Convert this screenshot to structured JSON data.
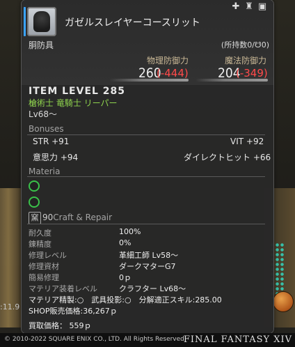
{
  "item": {
    "name": "ガゼルスレイヤーコースリット",
    "slot": "胴防具",
    "owned": "(所持数0/",
    "owned_suffix": "0)",
    "icons": [
      "plus-icon",
      "lock-icon",
      "camera-icon"
    ]
  },
  "stats": {
    "phys_label": "物理防御力",
    "phys_value": "260",
    "phys_diff": "(-444)",
    "mag_label": "魔法防御力",
    "mag_value": "204",
    "mag_diff": "(-349)"
  },
  "item_level": "ITEM LEVEL 285",
  "jobs": "槍術士 竜騎士 リーパー",
  "level_req": "Lv68～",
  "bonuses": {
    "title": "Bonuses",
    "items": [
      {
        "label": "STR +91"
      },
      {
        "label": "VIT +92"
      },
      {
        "label": "意思力 +94"
      },
      {
        "label": "ダイレクトヒット +66"
      }
    ]
  },
  "materia": {
    "title": "Materia",
    "slots": 2
  },
  "craft": {
    "icon": "窯",
    "level": "90",
    "title": "Craft & Repair",
    "rows": [
      {
        "label": "耐久度",
        "value": "100%"
      },
      {
        "label": "錬精度",
        "value": "0%"
      },
      {
        "label": "修理レベル",
        "value": "革細工師 Lv58～"
      },
      {
        "label": "修理資材",
        "value": "ダークマターG7"
      },
      {
        "label": "簡易修理",
        "value": "0ｐ"
      },
      {
        "label": "マテリア装着レベル",
        "value": "クラフター Lv68～"
      }
    ],
    "materia_line": "マテリア精製:○　武具投影:○　分解適正スキル:285.00",
    "shop_price": "SHOP販売価格:36,267ｐ",
    "buy_price": "買取価格：  559ｐ"
  },
  "footer": {
    "copyright": "© 2010-2022 SQUARE ENIX CO., LTD. All Rights Reserved.",
    "logo": "FINAL FANTASY XIV"
  },
  "background": {
    "left_text": ":11.9"
  }
}
